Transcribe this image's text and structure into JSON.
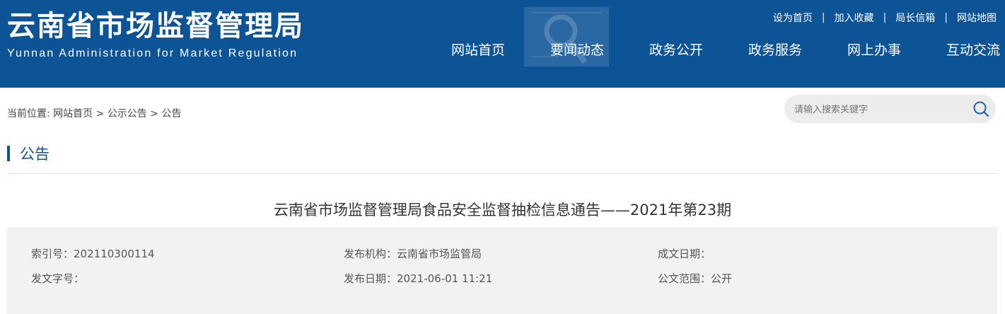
{
  "site": {
    "title_cn": "云南省市场监督管理局",
    "title_en": "Yunnan Administration for Market Regulation"
  },
  "top_links": [
    "设为首页",
    "加入收藏",
    "局长信箱",
    "网站地图"
  ],
  "top_link_separator": "|",
  "nav": [
    "网站首页",
    "要闻动态",
    "政务公开",
    "政务服务",
    "网上办事",
    "互动交流"
  ],
  "breadcrumb": {
    "prefix": "当前位置:",
    "items": [
      "网站首页",
      "公示公告",
      "公告"
    ],
    "separator": ">"
  },
  "search": {
    "placeholder": "请输入搜索关键字",
    "icon": "search-icon"
  },
  "section": {
    "title": "公告"
  },
  "article": {
    "title": "云南省市场监督管理局食品安全监督抽检信息通告——2021年第23期"
  },
  "meta": {
    "index_no_label": "索引号：",
    "index_no_value": "202110300114",
    "publisher_label": "发布机构：",
    "publisher_value": "云南省市场监管局",
    "doc_date_label": "成文日期：",
    "doc_date_value": "",
    "doc_no_label": "发文字号：",
    "doc_no_value": "",
    "publish_date_label": "发布日期：",
    "publish_date_value": "2021-06-01 11:21",
    "scope_label": "公文范围：",
    "scope_value": "公开"
  },
  "colors": {
    "header_bg": "#0d5497",
    "accent": "#0d5497",
    "meta_bg": "#f2f2f2"
  }
}
